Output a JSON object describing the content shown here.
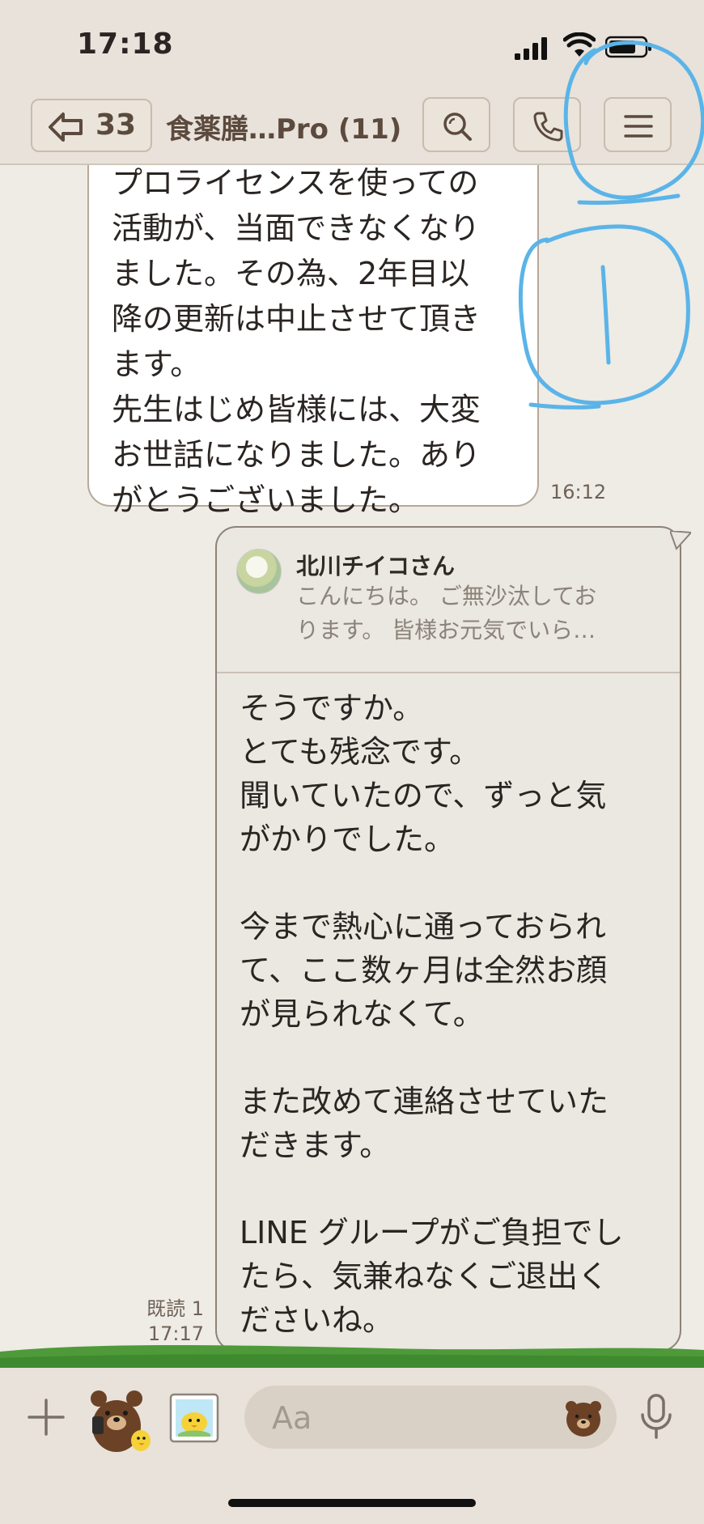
{
  "status_bar": {
    "time": "17:18"
  },
  "header": {
    "back_count": "33",
    "title": "食薬膳…Pro (11)"
  },
  "messages": {
    "received": {
      "text": "プロライセンスを使っての\n活動が、当面できなくなり\nました。その為、2年目以\n降の更新は中止させて頂き\nます。\n先生はじめ皆様には、大変\nお世話になりました。あり\nがとうございました。",
      "time": "16:12"
    },
    "sent": {
      "quote_name": "北川チイコさん",
      "quote_preview": "こんにちは。 ご無沙汰してお\nります。 皆様お元気でいら…",
      "text": "そうですか。\nとても残念です。\n聞いていたので、ずっと気\nがかりでした。\n\n今まで熱心に通っておられ\nて、ここ数ヶ月は全然お顔\nが見られなくて。\n\nまた改めて連絡させていた\nだきます。\n\nLINE グループがご負担でし\nたら、気兼ねなくご退出く\nださいね。",
      "read_status": "既読 1",
      "time": "17:17"
    }
  },
  "input": {
    "placeholder": "Aa"
  },
  "colors": {
    "background": "#efebe5",
    "header": "#e8e2da",
    "accent_brown": "#5b4a3d",
    "annotation": "#5ab4e8"
  }
}
